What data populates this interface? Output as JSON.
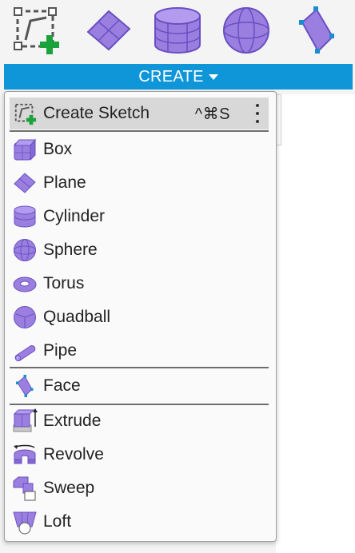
{
  "colors": {
    "accent": "#0e96d9",
    "icon_purple": "#9a7fe0",
    "icon_stroke": "#6a4fc0",
    "plus_green": "#1aa33a"
  },
  "toolbar": {
    "tools": [
      {
        "icon": "create-sketch-icon"
      },
      {
        "icon": "plane-icon"
      },
      {
        "icon": "cylinder-icon"
      },
      {
        "icon": "sphere-icon"
      },
      {
        "icon": "face-icon"
      }
    ],
    "create_label": "CREATE"
  },
  "menu": {
    "create_sketch": {
      "label": "Create Sketch",
      "shortcut": "^⌘S",
      "icon": "create-sketch-icon"
    },
    "primitives": [
      {
        "label": "Box",
        "icon": "box-icon"
      },
      {
        "label": "Plane",
        "icon": "plane-icon"
      },
      {
        "label": "Cylinder",
        "icon": "cylinder-icon"
      },
      {
        "label": "Sphere",
        "icon": "sphere-icon"
      },
      {
        "label": "Torus",
        "icon": "torus-icon"
      },
      {
        "label": "Quadball",
        "icon": "quadball-icon"
      },
      {
        "label": "Pipe",
        "icon": "pipe-icon"
      }
    ],
    "face": {
      "label": "Face",
      "icon": "face-icon"
    },
    "operations": [
      {
        "label": "Extrude",
        "icon": "extrude-icon"
      },
      {
        "label": "Revolve",
        "icon": "revolve-icon"
      },
      {
        "label": "Sweep",
        "icon": "sweep-icon"
      },
      {
        "label": "Loft",
        "icon": "loft-icon"
      }
    ]
  }
}
